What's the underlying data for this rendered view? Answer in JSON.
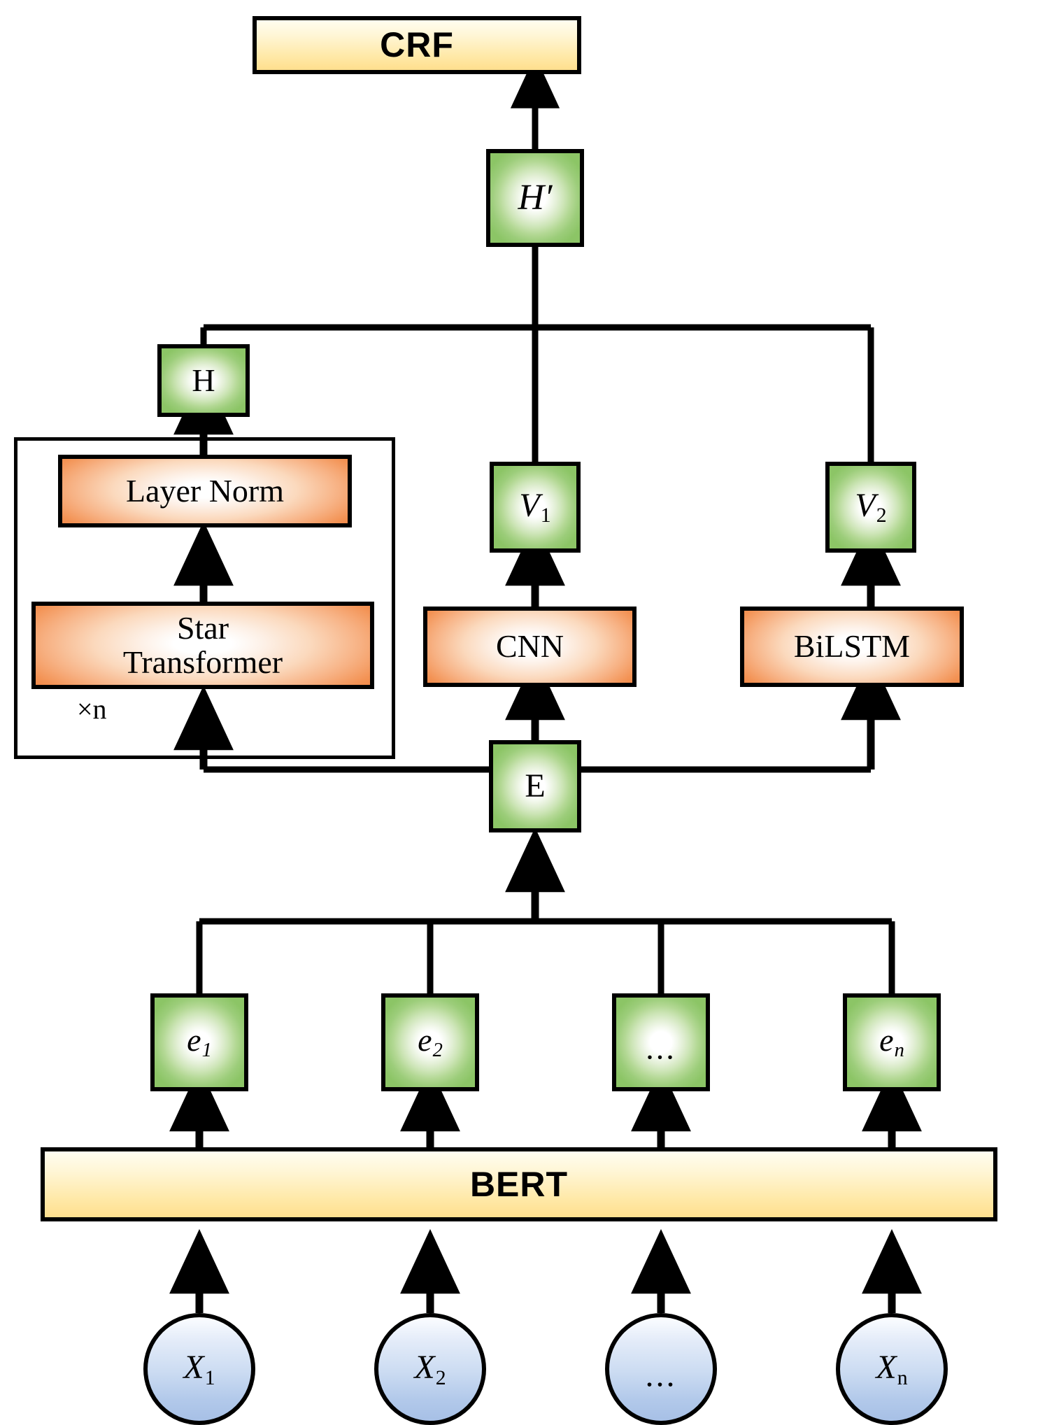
{
  "diagram": {
    "title": "BERT + Star-Transformer / CNN / BiLSTM + CRF sequence labeling architecture",
    "repeat_label": "×n",
    "colors": {
      "yellow_bar": "#ffdf8e",
      "orange_box": "#f18a49",
      "green_box": "#8cc566",
      "blue_circle": "#b2c9ea",
      "outline": "#000000"
    }
  },
  "nodes": {
    "crf": {
      "label": "CRF"
    },
    "h_prime": {
      "label": "H",
      "prime": "′"
    },
    "h": {
      "label": "H"
    },
    "layer_norm": {
      "label": "Layer Norm"
    },
    "star_transformer": {
      "line1": "Star",
      "line2": "Transformer"
    },
    "cnn": {
      "label": "CNN"
    },
    "bilstm": {
      "label": "BiLSTM"
    },
    "v1": {
      "label": "V",
      "sub": "1"
    },
    "v2": {
      "label": "V",
      "sub": "2"
    },
    "e": {
      "label": "E"
    },
    "bert": {
      "label": "BERT"
    }
  },
  "embeddings": [
    {
      "base": "e",
      "sub": "1",
      "sub_italic": true,
      "is_dots": false
    },
    {
      "base": "e",
      "sub": "2",
      "sub_italic": true,
      "is_dots": false
    },
    {
      "base": "",
      "sub": "",
      "sub_italic": false,
      "is_dots": true,
      "dots": "..."
    },
    {
      "base": "e",
      "sub": "n",
      "sub_italic": true,
      "is_dots": false
    }
  ],
  "inputs": [
    {
      "base": "X",
      "sub": "1",
      "sub_italic": false,
      "is_dots": false
    },
    {
      "base": "X",
      "sub": "2",
      "sub_italic": false,
      "is_dots": false
    },
    {
      "base": "",
      "sub": "",
      "sub_italic": false,
      "is_dots": true,
      "dots": "..."
    },
    {
      "base": "X",
      "sub": "n",
      "sub_italic": false,
      "is_dots": false
    }
  ]
}
